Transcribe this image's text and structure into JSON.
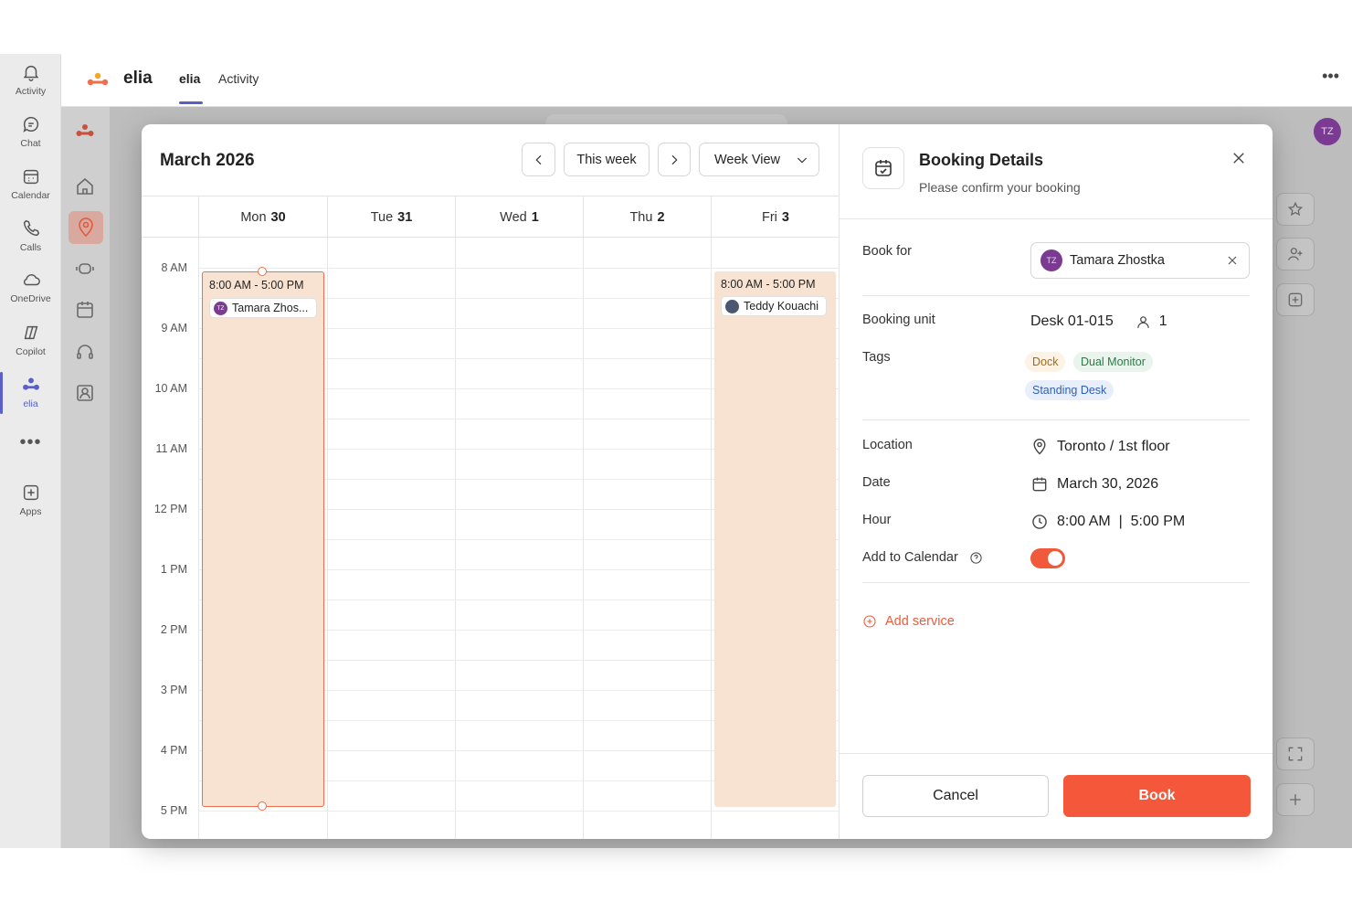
{
  "rail": {
    "items": [
      {
        "label": "Activity",
        "icon": "bell-icon"
      },
      {
        "label": "Chat",
        "icon": "chat-icon"
      },
      {
        "label": "Calendar",
        "icon": "calendar-icon"
      },
      {
        "label": "Calls",
        "icon": "phone-icon"
      },
      {
        "label": "OneDrive",
        "icon": "cloud-icon"
      },
      {
        "label": "Copilot",
        "icon": "copilot-icon"
      },
      {
        "label": "elia",
        "icon": "elia-logo-icon"
      },
      {
        "label": "Apps",
        "icon": "plus-square-icon"
      }
    ],
    "more": "•••"
  },
  "header": {
    "app_name": "elia",
    "tabs": [
      {
        "label": "elia"
      },
      {
        "label": "Activity"
      }
    ],
    "more": "•••"
  },
  "background": {
    "avatar_initials": "TZ"
  },
  "calendar": {
    "title": "March 2026",
    "this_week_label": "This week",
    "view_label": "Week View",
    "days": [
      {
        "name": "Mon",
        "num": "30"
      },
      {
        "name": "Tue",
        "num": "31"
      },
      {
        "name": "Wed",
        "num": "1"
      },
      {
        "name": "Thu",
        "num": "2"
      },
      {
        "name": "Fri",
        "num": "3"
      }
    ],
    "hours": [
      "8 AM",
      "9 AM",
      "10 AM",
      "11 AM",
      "12 PM",
      "1 PM",
      "2 PM",
      "3 PM",
      "4 PM",
      "5 PM"
    ],
    "events": [
      {
        "day": "Mon",
        "time": "8:00 AM - 5:00 PM",
        "person": "Tamara Zhos...",
        "initials": "TZ",
        "selected": true
      },
      {
        "day": "Fri",
        "time": "8:00 AM - 5:00 PM",
        "person": "Teddy Kouachi",
        "initials": "",
        "selected": false
      }
    ]
  },
  "details": {
    "title": "Booking Details",
    "subtitle": "Please confirm your booking",
    "book_for_label": "Book for",
    "book_for": {
      "name": "Tamara Zhostka",
      "initials": "TZ"
    },
    "booking_unit_label": "Booking unit",
    "booking_unit": "Desk 01-015",
    "capacity": "1",
    "tags_label": "Tags",
    "tags": [
      "Dock",
      "Dual Monitor",
      "Standing Desk"
    ],
    "location_label": "Location",
    "location": "Toronto / 1st floor",
    "date_label": "Date",
    "date": "March 30, 2026",
    "hour_label": "Hour",
    "hour": "8:00 AM  |  5:00 PM",
    "add_to_calendar_label": "Add to Calendar",
    "add_to_calendar": true,
    "add_service_label": "Add service",
    "cancel_label": "Cancel",
    "book_label": "Book",
    "accent_color": "#f5573a"
  }
}
